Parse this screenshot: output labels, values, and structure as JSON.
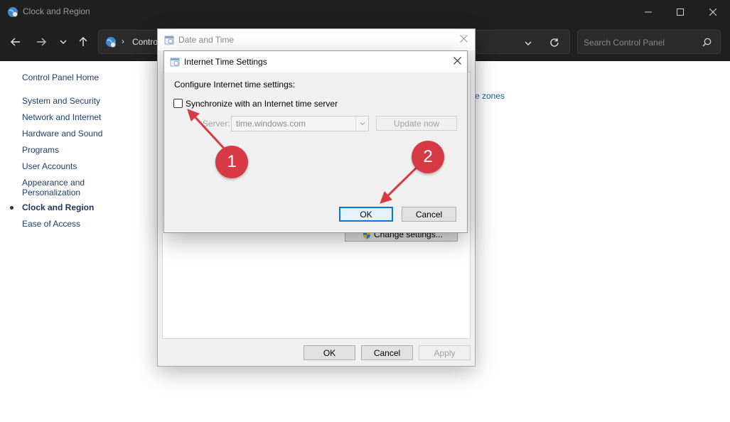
{
  "window": {
    "title": "Clock and Region"
  },
  "navbar": {
    "address_text": "Contro",
    "address_sep": "›",
    "search_placeholder": "Search Control Panel"
  },
  "sidebar": {
    "home": "Control Panel Home",
    "items": [
      {
        "label": "System and Security"
      },
      {
        "label": "Network and Internet"
      },
      {
        "label": "Hardware and Sound"
      },
      {
        "label": "Programs"
      },
      {
        "label": "User Accounts"
      },
      {
        "label": "Appearance and Personalization"
      },
      {
        "label": "Clock and Region",
        "active": true
      },
      {
        "label": "Ease of Access"
      }
    ]
  },
  "background": {
    "link_fragment": "me zones"
  },
  "date_time_dialog": {
    "title": "Date and Time",
    "change_settings_label": "Change settings...",
    "ok_label": "OK",
    "cancel_label": "Cancel",
    "apply_label": "Apply"
  },
  "internet_time_dialog": {
    "title": "Internet Time Settings",
    "heading": "Configure Internet time settings:",
    "sync_checkbox_label": "Synchronize with an Internet time server",
    "sync_checked": false,
    "server_label": "Server:",
    "server_value": "time.windows.com",
    "update_now_label": "Update now",
    "ok_label": "OK",
    "cancel_label": "Cancel"
  },
  "annotations": {
    "callout_1": "1",
    "callout_2": "2",
    "color": "#d73a44"
  },
  "colors": {
    "titlebar_bg": "#202020",
    "link": "#1c3f6f",
    "accent": "#0078d7"
  }
}
